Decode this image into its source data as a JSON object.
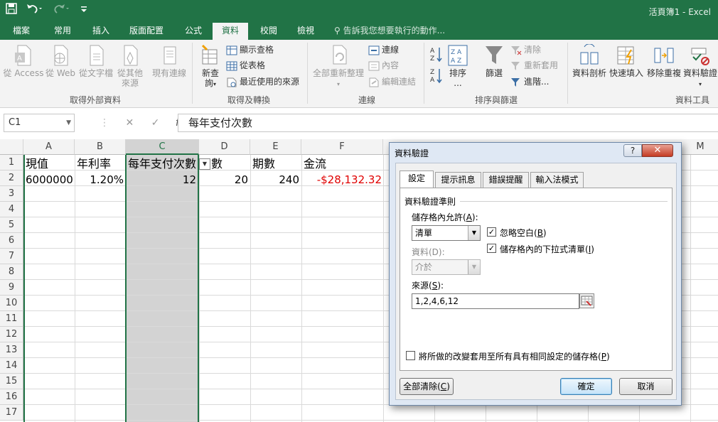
{
  "window": {
    "title": "活頁簿1 - Excel",
    "qat": {
      "save_icon": "save-icon",
      "undo_icon": "undo-icon",
      "redo_icon": "redo-icon",
      "customize_icon": "customize-qat-icon"
    }
  },
  "tabs": [
    {
      "label": "檔案"
    },
    {
      "label": "常用"
    },
    {
      "label": "插入"
    },
    {
      "label": "版面配置"
    },
    {
      "label": "公式"
    },
    {
      "label": "資料",
      "active": true
    },
    {
      "label": "校閱"
    },
    {
      "label": "檢視"
    }
  ],
  "tell_me": "告訴我您想要執行的動作...",
  "ribbon": {
    "get_external": {
      "label": "取得外部資料",
      "items": [
        {
          "label1": "從 Access",
          "label2": ""
        },
        {
          "label1": "從 Web",
          "label2": ""
        },
        {
          "label1": "從文字檔",
          "label2": ""
        },
        {
          "label1": "從其他",
          "label2": "來源"
        },
        {
          "label1": "現有連線",
          "label2": ""
        }
      ]
    },
    "get_transform": {
      "label": "取得及轉換",
      "new_query1": "新查",
      "new_query2": "詢",
      "show_queries": "顯示查格",
      "from_table": "從表格",
      "recent_sources": "最近使用的來源"
    },
    "connections": {
      "label": "連線",
      "refresh_all": "全部重新整理",
      "connections": "連線",
      "properties": "內容",
      "edit_links": "編輯連結"
    },
    "sort_filter": {
      "label": "排序與篩選",
      "sort": "排序",
      "sort_more": "...",
      "filter": "篩選",
      "clear": "清除",
      "reapply": "重新套用",
      "advanced": "進階..."
    },
    "data_tools": {
      "label": "資料工具",
      "text_to_columns": "資料剖析",
      "flash_fill": "快速填入",
      "remove_duplicates": "移除重複",
      "data_validation": "資料驗證"
    }
  },
  "formula_bar": {
    "name_box": "C1",
    "cancel_icon": "✕",
    "enter_icon": "✓",
    "fx": "fx",
    "content": "每年支付次數"
  },
  "grid": {
    "columns": [
      "A",
      "B",
      "C",
      "D",
      "E",
      "F",
      "M"
    ],
    "rows": [
      "1",
      "2",
      "3",
      "4",
      "5",
      "6",
      "7",
      "8",
      "9",
      "10",
      "11",
      "12",
      "13",
      "14",
      "15",
      "16",
      "17"
    ],
    "cells": {
      "A1": "現值",
      "B1": "年利率",
      "C1": "每年支付次數",
      "D1": "數",
      "E1": "期數",
      "F1": "金流",
      "A2": "6000000",
      "B2": "1.20%",
      "C2": "12",
      "D2": "20",
      "E2": "240",
      "F2": "-$28,132.32"
    },
    "negative_color": "#e00000"
  },
  "dialog": {
    "title": "資料驗證",
    "help": "?",
    "close": "✕",
    "tabs": [
      "設定",
      "提示訊息",
      "錯誤提醒",
      "輸入法模式"
    ],
    "section": "資料驗證準則",
    "allow_label_pre": "儲存格內允許(",
    "allow_key": "A",
    "allow_label_post": "):",
    "allow_value": "清單",
    "ignore_blank_pre": "忽略空白(",
    "ignore_blank_key": "B",
    "ignore_blank_post": ")",
    "ignore_blank_checked": true,
    "in_cell_dropdown_pre": "儲存格內的下拉式清單(",
    "in_cell_dropdown_key": "I",
    "in_cell_dropdown_post": ")",
    "in_cell_dropdown_checked": true,
    "data_label": "資料(D):",
    "data_value": "介於",
    "source_label_pre": "來源(",
    "source_key": "S",
    "source_label_post": "):",
    "source_value": "1,2,4,6,12",
    "apply_all_pre": "將所做的改變套用至所有具有相同設定的儲存格(",
    "apply_all_key": "P",
    "apply_all_post": ")",
    "apply_all_checked": false,
    "clear_all_pre": "全部清除(",
    "clear_all_key": "C",
    "clear_all_post": ")",
    "ok": "確定",
    "cancel": "取消"
  },
  "colors": {
    "excel_green": "#217346"
  }
}
